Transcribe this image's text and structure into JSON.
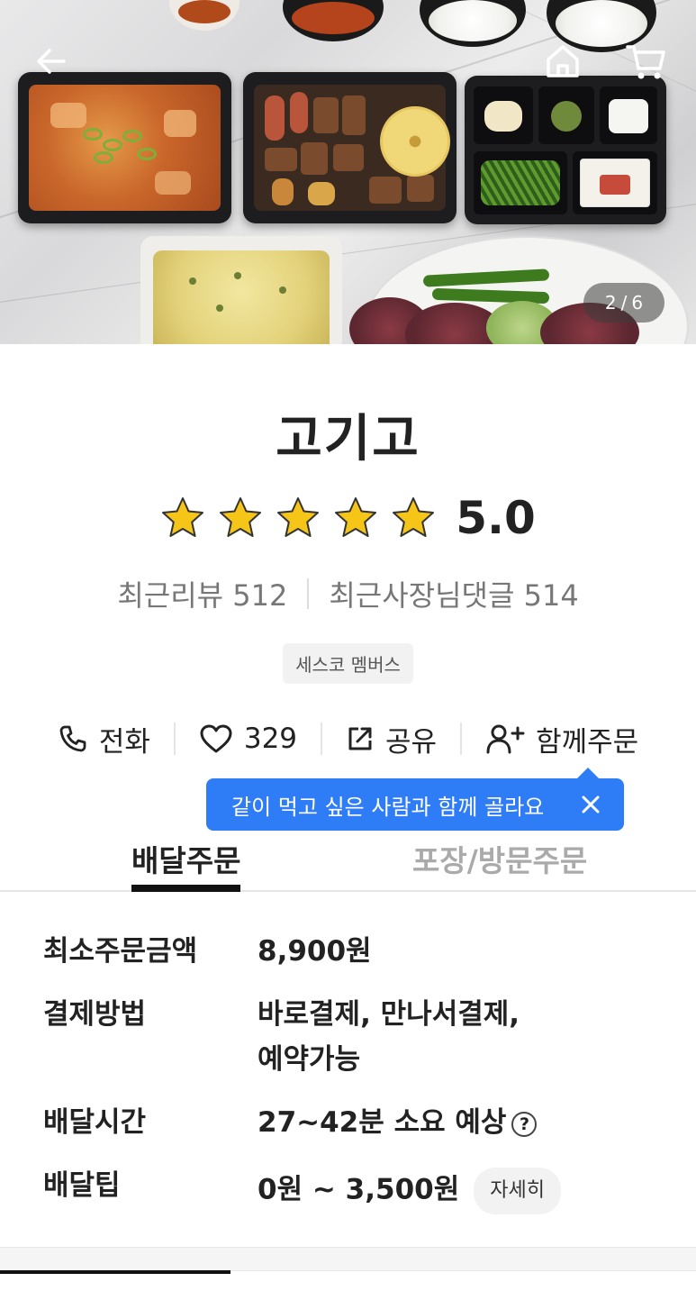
{
  "header": {
    "image_index": "2",
    "image_sep": "/",
    "image_total": "6",
    "icons": [
      "back-arrow-icon",
      "home-icon",
      "cart-icon"
    ]
  },
  "store": {
    "name": "고기고",
    "rating": "5.0",
    "stars": 5,
    "recent_reviews_label": "최근리뷰",
    "recent_reviews_count": "512",
    "owner_replies_label": "최근사장님댓글",
    "owner_replies_count": "514",
    "badge": "세스코 멤버스"
  },
  "actions": {
    "call_label": "전화",
    "like_count": "329",
    "share_label": "공유",
    "group_order_label": "함께주문"
  },
  "tooltip": {
    "text": "같이 먹고 싶은 사람과 함께 골라요"
  },
  "tabs": [
    {
      "label": "배달주문",
      "active": true
    },
    {
      "label": "포장/방문주문",
      "active": false
    }
  ],
  "delivery_info": {
    "min_order_label": "최소주문금액",
    "min_order_value": "8,900원",
    "payment_label": "결제방법",
    "payment_value_line1": "바로결제, 만나서결제,",
    "payment_value_line2": "예약가능",
    "time_label": "배달시간",
    "time_value": "27~42분 소요 예상",
    "tip_label": "배달팁",
    "tip_value": "0원 ~ 3,500원",
    "tip_detail_button": "자세히"
  },
  "colors": {
    "accent_blue": "#2f7df6",
    "star_yellow": "#f5c518",
    "text_dark": "#222222",
    "text_muted": "#777777"
  }
}
